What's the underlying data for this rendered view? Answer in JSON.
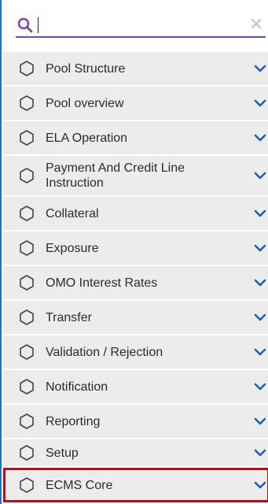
{
  "search": {
    "value": "",
    "placeholder": ""
  },
  "menu": {
    "items": [
      {
        "label": "Pool Structure"
      },
      {
        "label": "Pool overview"
      },
      {
        "label": "ELA Operation"
      },
      {
        "label": "Payment And Credit Line Instruction",
        "lines": [
          "Payment And Credit Line",
          "Instruction"
        ]
      },
      {
        "label": "Collateral"
      },
      {
        "label": "Exposure"
      },
      {
        "label": "OMO Interest Rates"
      },
      {
        "label": "Transfer"
      },
      {
        "label": "Validation / Rejection"
      },
      {
        "label": "Notification"
      },
      {
        "label": "Reporting"
      },
      {
        "label": "Setup"
      },
      {
        "label": "ECMS Core",
        "highlighted": true
      }
    ]
  },
  "colors": {
    "accent_purple": "#7a4a9c",
    "chevron_blue": "#1f5fb4",
    "item_bg": "#ececec",
    "highlight_border": "#b2101d",
    "left_border": "#2a71b8"
  },
  "icons": {
    "search": "search-icon",
    "clear": "close-icon",
    "item": "hexagon-icon",
    "expand": "chevron-down-icon"
  }
}
